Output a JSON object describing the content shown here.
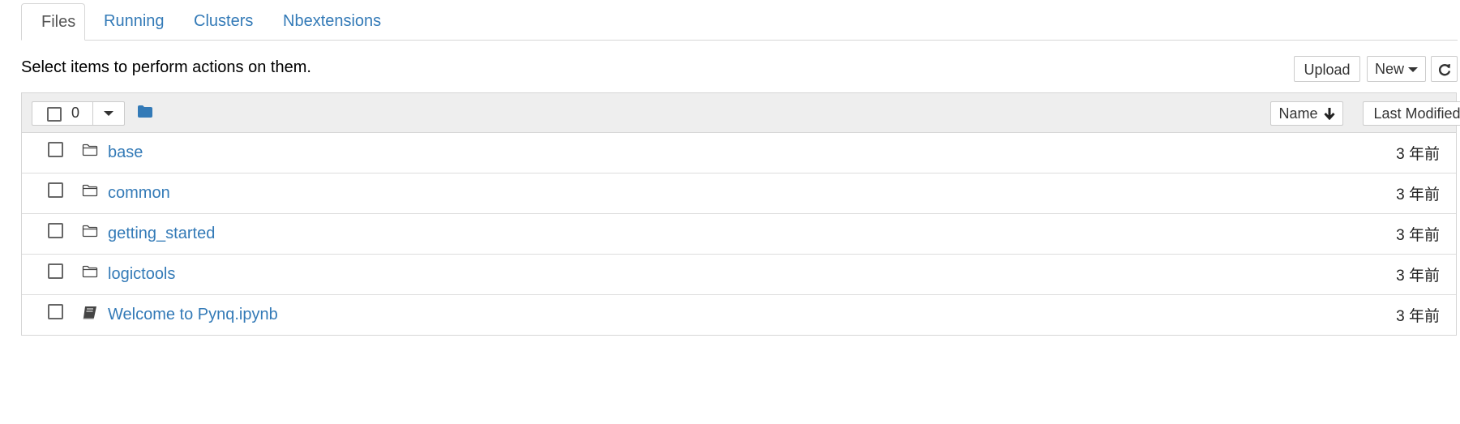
{
  "tabs": [
    {
      "label": "Files",
      "active": true
    },
    {
      "label": "Running",
      "active": false
    },
    {
      "label": "Clusters",
      "active": false
    },
    {
      "label": "Nbextensions",
      "active": false
    }
  ],
  "toolbar": {
    "hint": "Select items to perform actions on them.",
    "upload_label": "Upload",
    "new_label": "New",
    "refresh_icon": "refresh-icon"
  },
  "list_header": {
    "selected_count": "0",
    "folder_icon": "folder-icon",
    "sort_name_label": "Name",
    "sort_name_direction": "down",
    "sort_modified_label": "Last Modified"
  },
  "files": [
    {
      "name": "base",
      "type": "folder",
      "icon": "folder-open-outline-icon",
      "modified": "3 年前"
    },
    {
      "name": "common",
      "type": "folder",
      "icon": "folder-open-outline-icon",
      "modified": "3 年前"
    },
    {
      "name": "getting_started",
      "type": "folder",
      "icon": "folder-open-outline-icon",
      "modified": "3 年前"
    },
    {
      "name": "logictools",
      "type": "folder",
      "icon": "folder-open-outline-icon",
      "modified": "3 年前"
    },
    {
      "name": "Welcome to Pynq.ipynb",
      "type": "notebook",
      "icon": "book-icon",
      "modified": "3 年前"
    }
  ],
  "colors": {
    "link": "#337ab7",
    "header_bg": "#eeeeee",
    "border": "#d6d6d6"
  }
}
